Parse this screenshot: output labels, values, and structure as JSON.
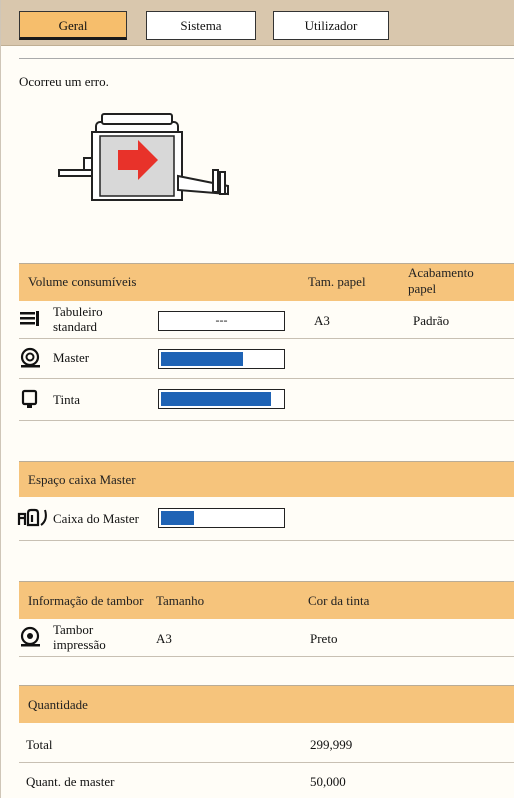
{
  "tabs": [
    {
      "label": "Geral",
      "active": true
    },
    {
      "label": "Sistema",
      "active": false
    },
    {
      "label": "Utilizador",
      "active": false
    }
  ],
  "message": "Ocorreu um erro.",
  "consumables": {
    "header": {
      "volume": "Volume consumíveis",
      "paper_size": "Tam. papel",
      "finish": "Acabamento papel"
    },
    "tray": {
      "label": "Tabuleiro standard",
      "level_text": "---",
      "paper_size": "A3",
      "finish": "Padrão"
    },
    "master": {
      "label": "Master",
      "level": 0.68
    },
    "ink": {
      "label": "Tinta",
      "level": 0.91
    }
  },
  "master_box": {
    "header": "Espaço caixa Master",
    "label": "Caixa do Master",
    "level": 0.27
  },
  "drum": {
    "header": {
      "info": "Informação de tambor",
      "size": "Tamanho",
      "ink_color": "Cor da tinta"
    },
    "label": "Tambor impressão",
    "size": "A3",
    "ink_color": "Preto"
  },
  "quantity": {
    "header": "Quantidade",
    "rows": [
      {
        "label": "Total",
        "value": "299,999"
      },
      {
        "label": "Quant. de master",
        "value": "50,000"
      }
    ]
  },
  "colors": {
    "tab_bar": "#d9c7ad",
    "header": "#f6c47c",
    "bar_fill": "#1f63b5",
    "arrow": "#e8322a"
  }
}
